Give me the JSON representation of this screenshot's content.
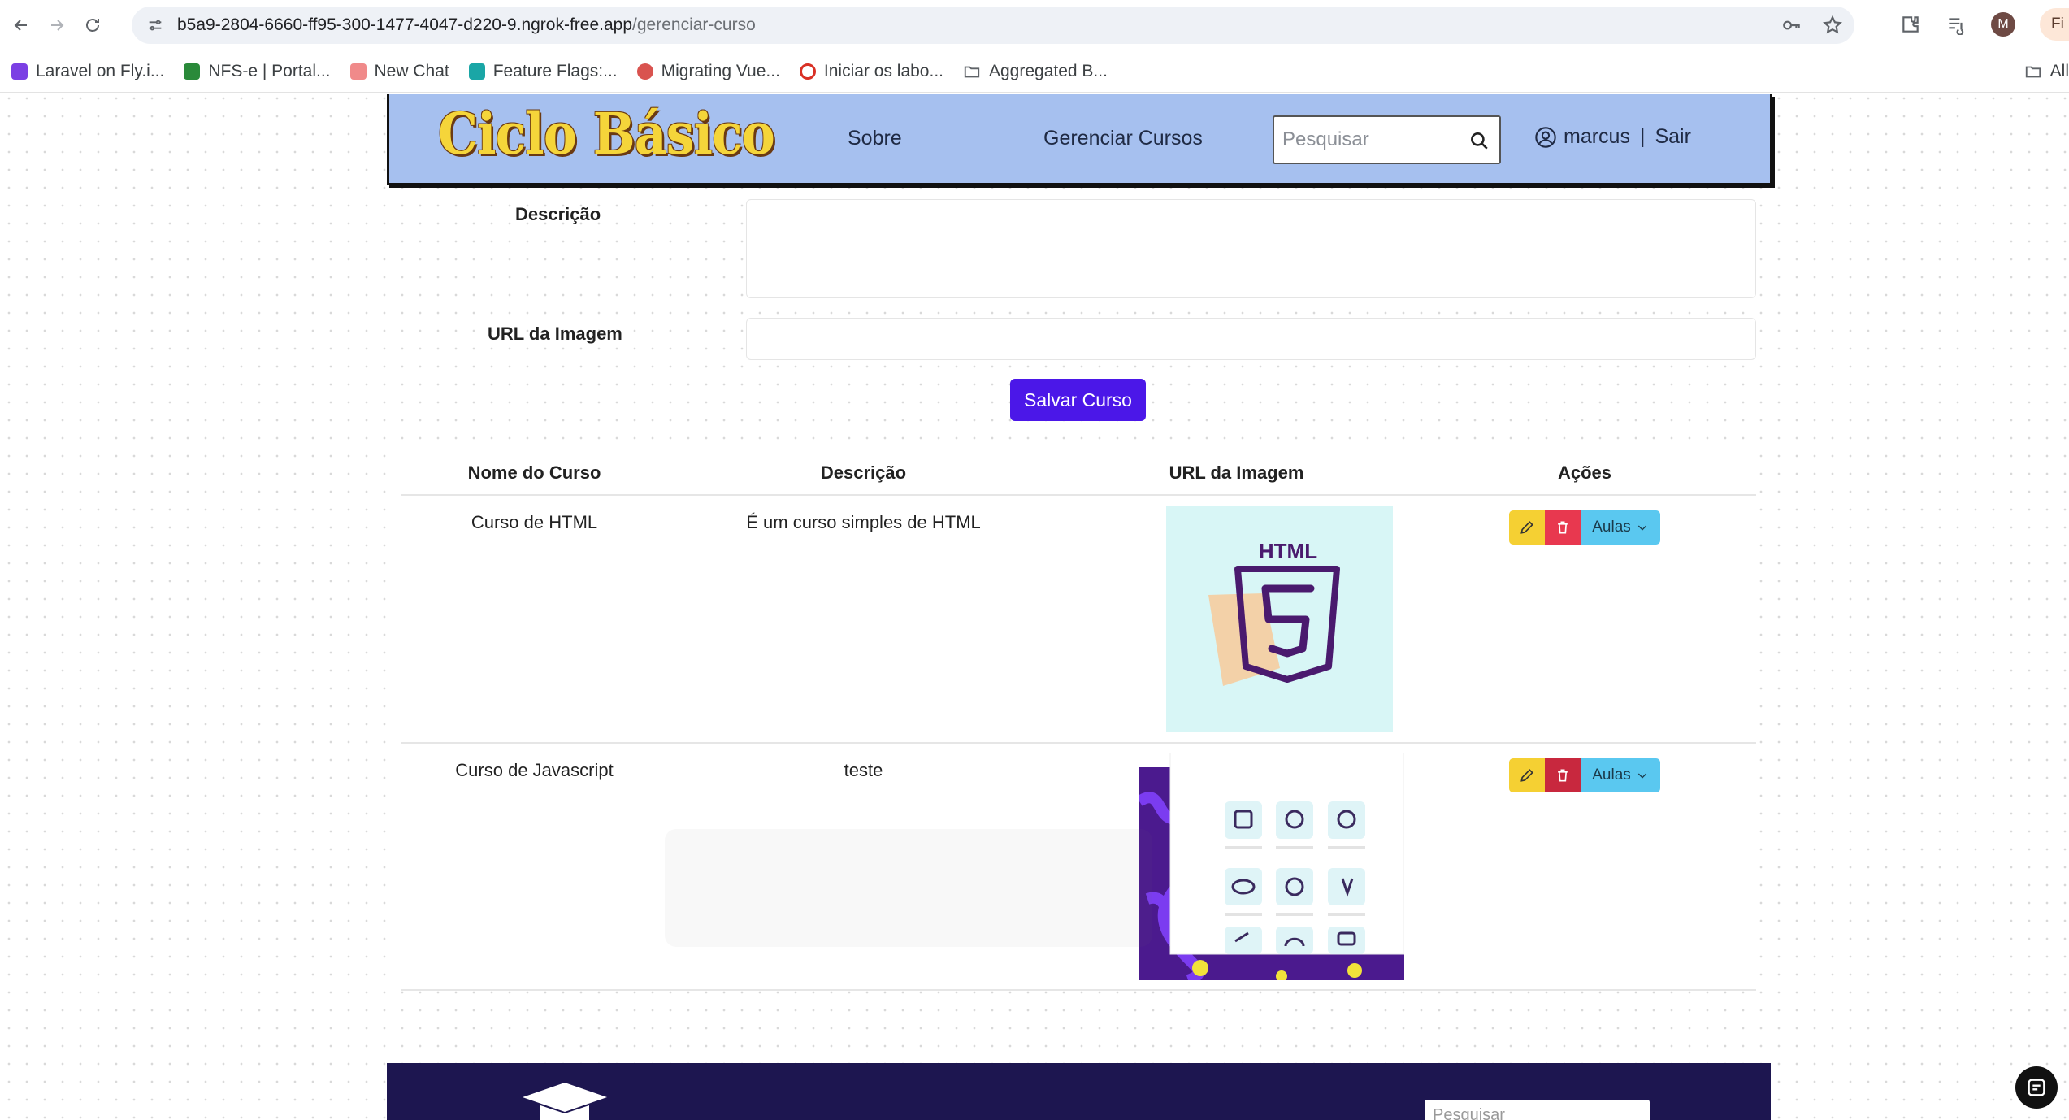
{
  "browser": {
    "url_host": "b5a9-2804-6660-ff95-300-1477-4047-d220-9.ngrok-free.app",
    "url_path": "/gerenciar-curso",
    "profile_initial": "M",
    "profile_pill_text": "Fi",
    "bookmarks": [
      {
        "label": "Laravel on Fly.i...",
        "icon_color": "#7b3fe4"
      },
      {
        "label": "NFS-e | Portal...",
        "icon_color": "#2a8a3a"
      },
      {
        "label": "New Chat",
        "icon_color": "#f08a8a"
      },
      {
        "label": "Feature Flags:...",
        "icon_color": "#1aa6a6"
      },
      {
        "label": "Migrating Vue...",
        "icon_color": "#d9534f"
      },
      {
        "label": "Iniciar os labo...",
        "icon_color": "#d93025"
      },
      {
        "label": "Aggregated B...",
        "icon_color": "folder"
      }
    ],
    "all_bookmarks_label": "All"
  },
  "navbar": {
    "logo_text": "Ciclo Básico",
    "links": [
      "Sobre",
      "Gerenciar Cursos"
    ],
    "search_placeholder": "Pesquisar",
    "username": "marcus",
    "separator": "|",
    "logout_label": "Sair"
  },
  "form": {
    "description_label": "Descrição",
    "image_url_label": "URL da Imagem",
    "save_label": "Salvar Curso"
  },
  "table": {
    "headers": [
      "Nome do Curso",
      "Descrição",
      "URL da Imagem",
      "Ações"
    ],
    "rows": [
      {
        "name": "Curso de HTML",
        "description": "É um curso simples de HTML",
        "image_label": "HTML",
        "aulas_label": "Aulas"
      },
      {
        "name": "Curso de Javascript",
        "description": "teste",
        "aulas_label": "Aulas"
      }
    ]
  },
  "footer": {
    "search_placeholder": "Pesquisar"
  },
  "colors": {
    "navbar_bg": "#a6c0ef",
    "primary": "#4b17e8",
    "edit": "#f5d033",
    "delete": "#e8384f",
    "aulas": "#5ac8f0",
    "footer_bg": "#1d1650"
  }
}
